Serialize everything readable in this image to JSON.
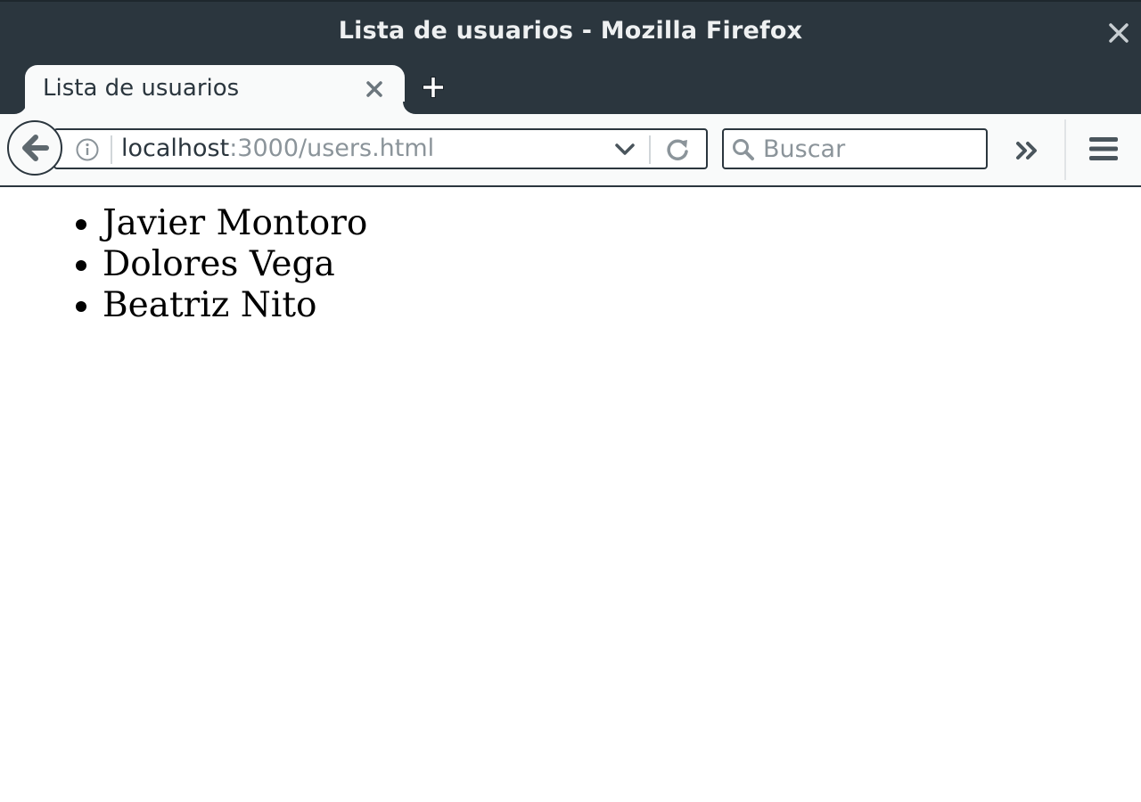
{
  "window": {
    "title": "Lista de usuarios - Mozilla Firefox"
  },
  "tabs": [
    {
      "title": "Lista de usuarios",
      "active": true
    }
  ],
  "navbar": {
    "url_host": "localhost",
    "url_path": ":3000/users.html",
    "search_placeholder": "Buscar"
  },
  "page": {
    "users": [
      "Javier Montoro",
      "Dolores Vega",
      "Beatriz Nito"
    ]
  },
  "colors": {
    "chrome_dark": "#2b363e",
    "toolbar_bg": "#f9fafa",
    "url_muted": "#8b949a"
  }
}
